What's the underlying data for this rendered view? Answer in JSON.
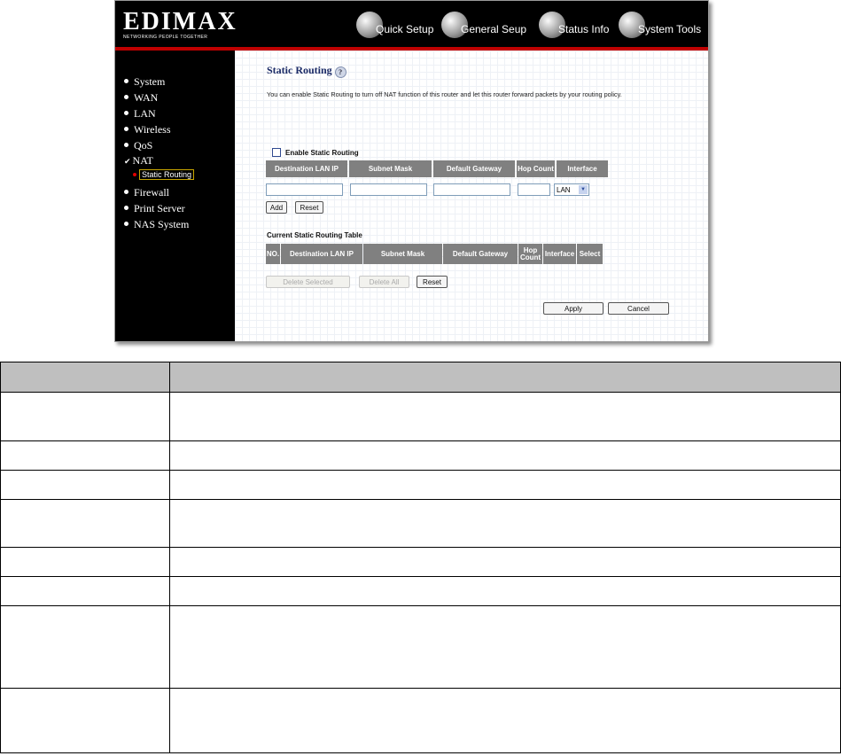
{
  "header": {
    "logo": "EDIMAX",
    "tagline": "NETWORKING PEOPLE TOGETHER",
    "nav": [
      {
        "label": "Quick Setup",
        "icon": "globe-icon"
      },
      {
        "label": "General Seup",
        "icon": "globe-icon"
      },
      {
        "label": "Status Info",
        "icon": "globe-icon"
      },
      {
        "label": "System Tools",
        "icon": "globe-icon"
      }
    ]
  },
  "sidebar": {
    "items": [
      {
        "label": "System"
      },
      {
        "label": "WAN"
      },
      {
        "label": "LAN"
      },
      {
        "label": "Wireless"
      },
      {
        "label": "QoS"
      },
      {
        "label": "NAT"
      },
      {
        "label": "Firewall"
      },
      {
        "label": "Print Server"
      },
      {
        "label": "NAS System"
      }
    ],
    "sub_item": "Static Routing"
  },
  "main": {
    "title": "Static Routing",
    "help_glyph": "?",
    "description": "You can enable Static Routing to turn off NAT function of this router and let this router forward packets by your routing policy.",
    "enable_label": "Enable Static Routing",
    "enable_checked": false,
    "input_headers": [
      "Destination LAN IP",
      "Subnet Mask",
      "Default Gateway",
      "Hop Count",
      "Interface"
    ],
    "interface_value": "LAN",
    "add_label": "Add",
    "reset_label": "Reset",
    "table_title": "Current Static Routing Table",
    "table_headers": [
      "NO.",
      "Destination LAN IP",
      "Subnet Mask",
      "Default Gateway",
      "Hop Count",
      "Interface",
      "Select"
    ],
    "delete_selected_label": "Delete Selected",
    "delete_all_label": "Delete All",
    "reset2_label": "Reset",
    "apply_label": "Apply",
    "cancel_label": "Cancel"
  },
  "colors": {
    "accent_red": "#c00000",
    "header_gray": "#808080",
    "title_navy": "#1a2a66"
  }
}
